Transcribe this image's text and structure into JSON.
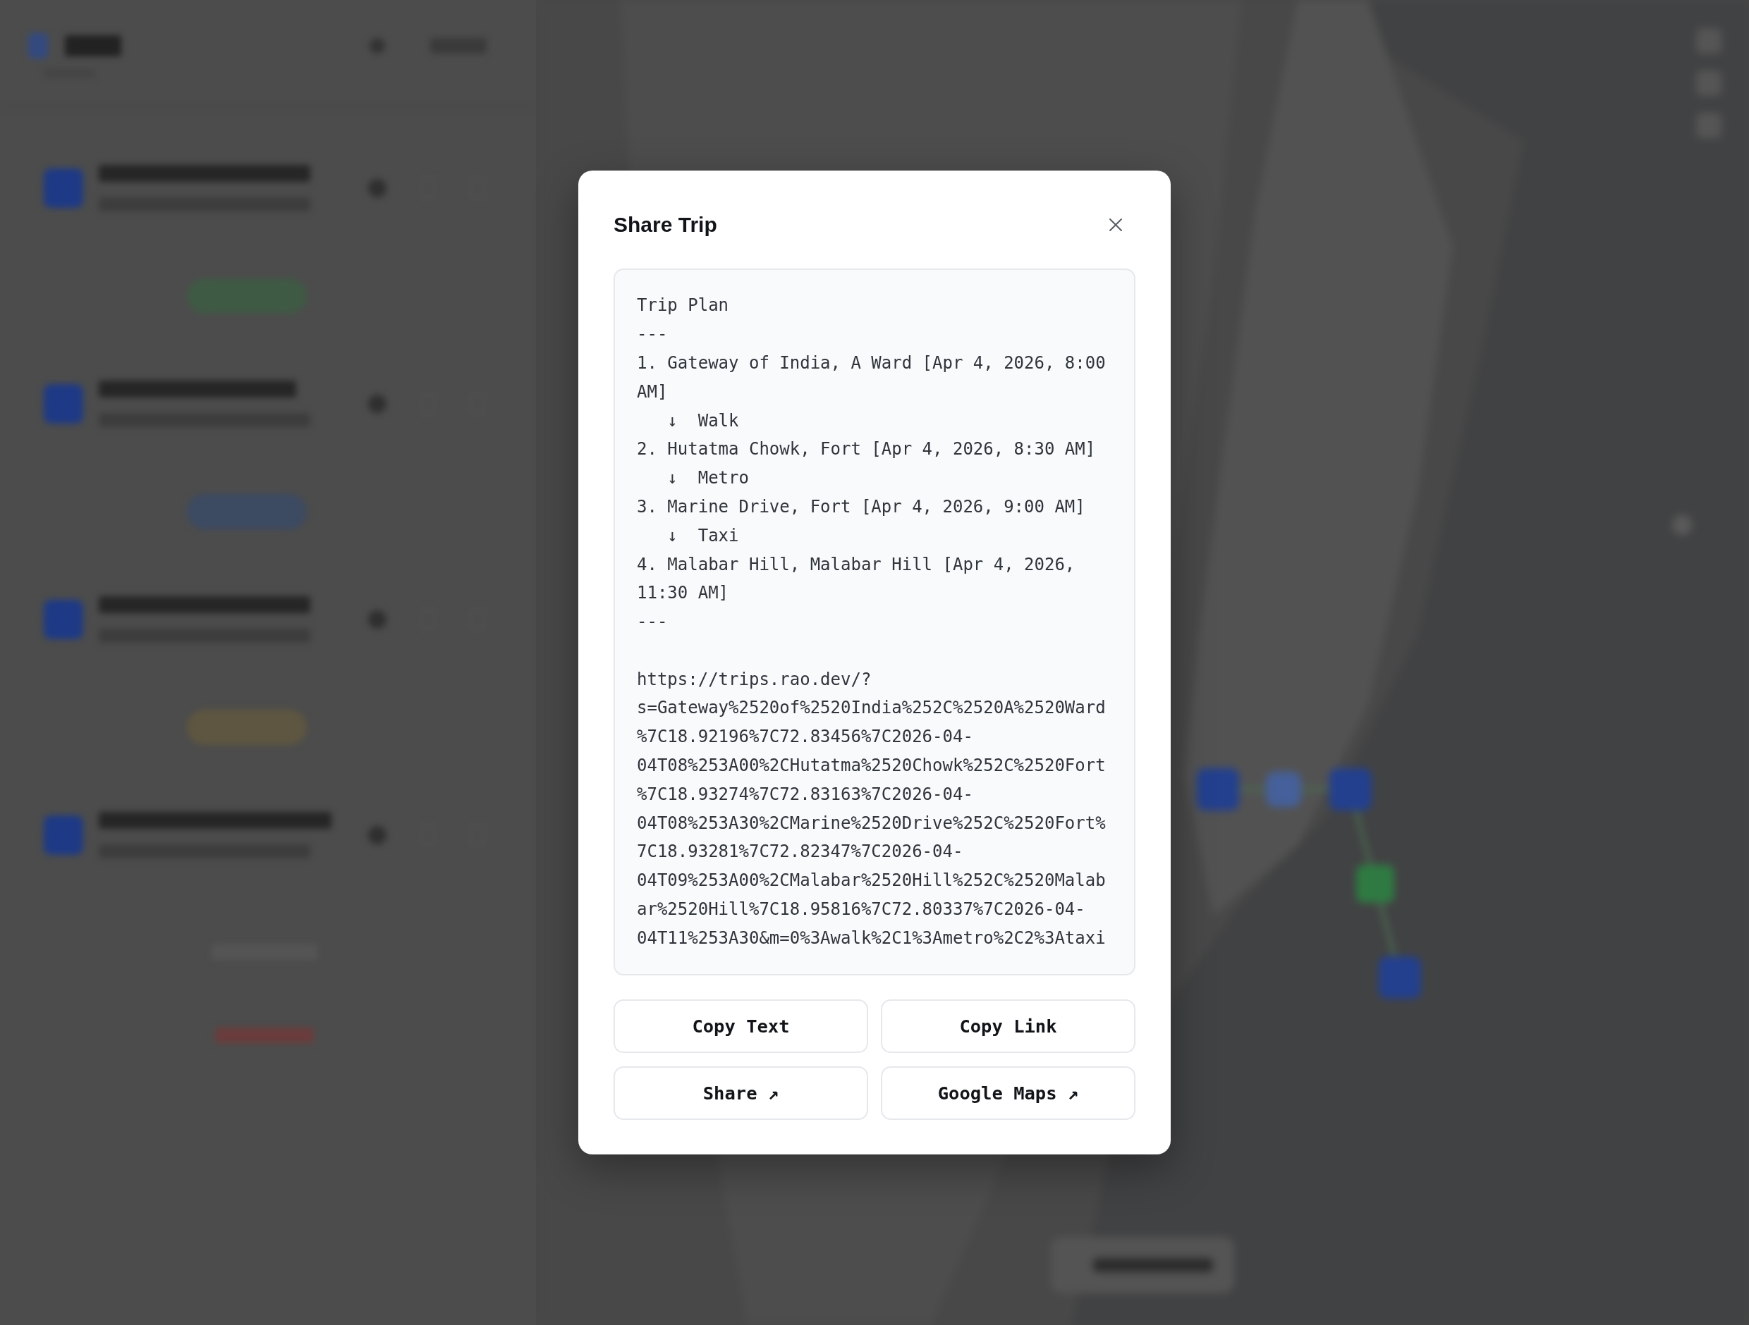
{
  "dialog": {
    "title": "Share Trip",
    "share_text": {
      "lines": [
        {
          "kind": "heading",
          "text": "Trip Plan"
        },
        {
          "kind": "rule",
          "text": "---"
        },
        {
          "kind": "stop",
          "text": "1. Gateway of India, A Ward [Apr 4, 2026, 8:00 AM]"
        },
        {
          "kind": "leg",
          "text": "↓  Walk"
        },
        {
          "kind": "stop",
          "text": "2. Hutatma Chowk, Fort [Apr 4, 2026, 8:30 AM]"
        },
        {
          "kind": "leg",
          "text": "↓  Metro"
        },
        {
          "kind": "stop",
          "text": "3. Marine Drive, Fort [Apr 4, 2026, 9:00 AM]"
        },
        {
          "kind": "leg",
          "text": "↓  Taxi"
        },
        {
          "kind": "stop",
          "text": "4. Malabar Hill, Malabar Hill [Apr 4, 2026, 11:30 AM]"
        },
        {
          "kind": "rule",
          "text": "---"
        }
      ],
      "link": "https://trips.rao.dev/?s=Gateway%2520of%2520India%252C%2520A%2520Ward%7C18.92196%7C72.83456%7C2026-04-04T08%253A00%2CHutatma%2520Chowk%252C%2520Fort%7C18.93274%7C72.83163%7C2026-04-04T08%253A30%2CMarine%2520Drive%252C%2520Fort%7C18.93281%7C72.82347%7C2026-04-04T09%253A00%2CMalabar%2520Hill%252C%2520Malabar%2520Hill%7C18.95816%7C72.80337%7C2026-04-04T11%253A30&m=0%3Awalk%2C1%3Ametro%2C2%3Ataxi"
    },
    "buttons": [
      {
        "label": "Copy Text"
      },
      {
        "label": "Copy Link"
      },
      {
        "label": "Share ↗"
      },
      {
        "label": "Google Maps ↗"
      }
    ]
  }
}
